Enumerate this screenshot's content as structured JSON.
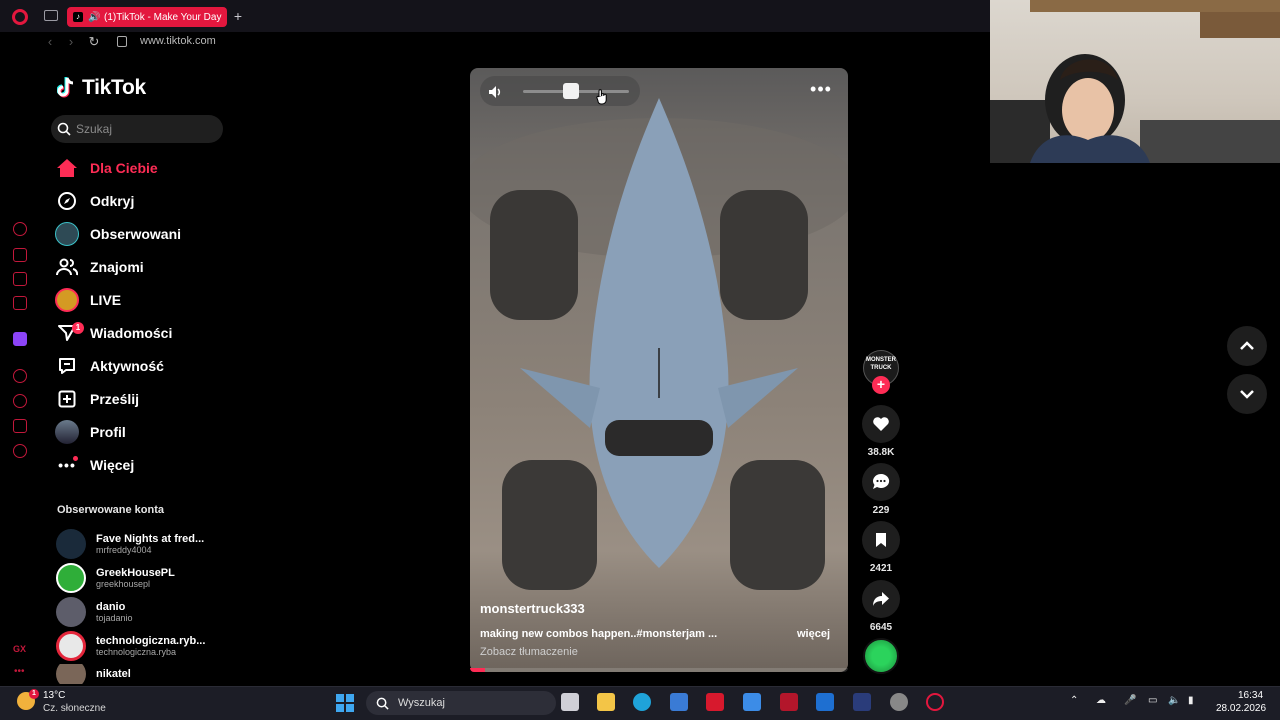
{
  "browser": {
    "tab_title": "(1)TikTok - Make Your Day",
    "new_tab": "+",
    "url": "www.tiktok.com"
  },
  "tiktok": {
    "logo_text": "TikTok",
    "search_placeholder": "Szukaj",
    "nav": [
      {
        "label": "Dla Ciebie",
        "icon": "home-icon",
        "active": true
      },
      {
        "label": "Odkryj",
        "icon": "compass-icon"
      },
      {
        "label": "Obserwowani",
        "icon": "avatar-icon"
      },
      {
        "label": "Znajomi",
        "icon": "friends-icon"
      },
      {
        "label": "LIVE",
        "icon": "live-icon"
      },
      {
        "label": "Wiadomości",
        "icon": "send-icon"
      },
      {
        "label": "Aktywność",
        "icon": "inbox-icon"
      },
      {
        "label": "Prześlij",
        "icon": "upload-icon"
      },
      {
        "label": "Profil",
        "icon": "profile-avatar-icon"
      },
      {
        "label": "Więcej",
        "icon": "more-icon"
      }
    ],
    "messages_badge": "1",
    "followed_title": "Obserwowane konta",
    "followed": [
      {
        "name": "Fave Nights at fred...",
        "handle": "mrfreddy4004"
      },
      {
        "name": "GreekHousePL",
        "handle": "greekhousepl"
      },
      {
        "name": "danio",
        "handle": "tojadanio"
      },
      {
        "name": "technologiczna.ryb...",
        "handle": "technologiczna.ryba"
      },
      {
        "name": "nikatel",
        "handle": ""
      }
    ]
  },
  "video": {
    "username": "monstertruck333",
    "description": "making new combos happen..#monsterjam ...",
    "more_label": "więcej",
    "translate_label": "Zobacz tłumaczenie",
    "volume_level": 0.45,
    "progress": 0.04,
    "creator_badge": "MONSTER TRUCK",
    "follow_label": "+",
    "likes": "38.8K",
    "comments": "229",
    "saves": "2421",
    "shares": "6645"
  },
  "taskbar": {
    "weather_badge": "1",
    "temperature": "13°C",
    "weather_desc": "Cz. słoneczne",
    "search_label": "Wyszukaj",
    "time": "16:34",
    "date": "28.02.2026"
  },
  "colors": {
    "accent": "#fe2c55",
    "opera": "#e3173e"
  }
}
